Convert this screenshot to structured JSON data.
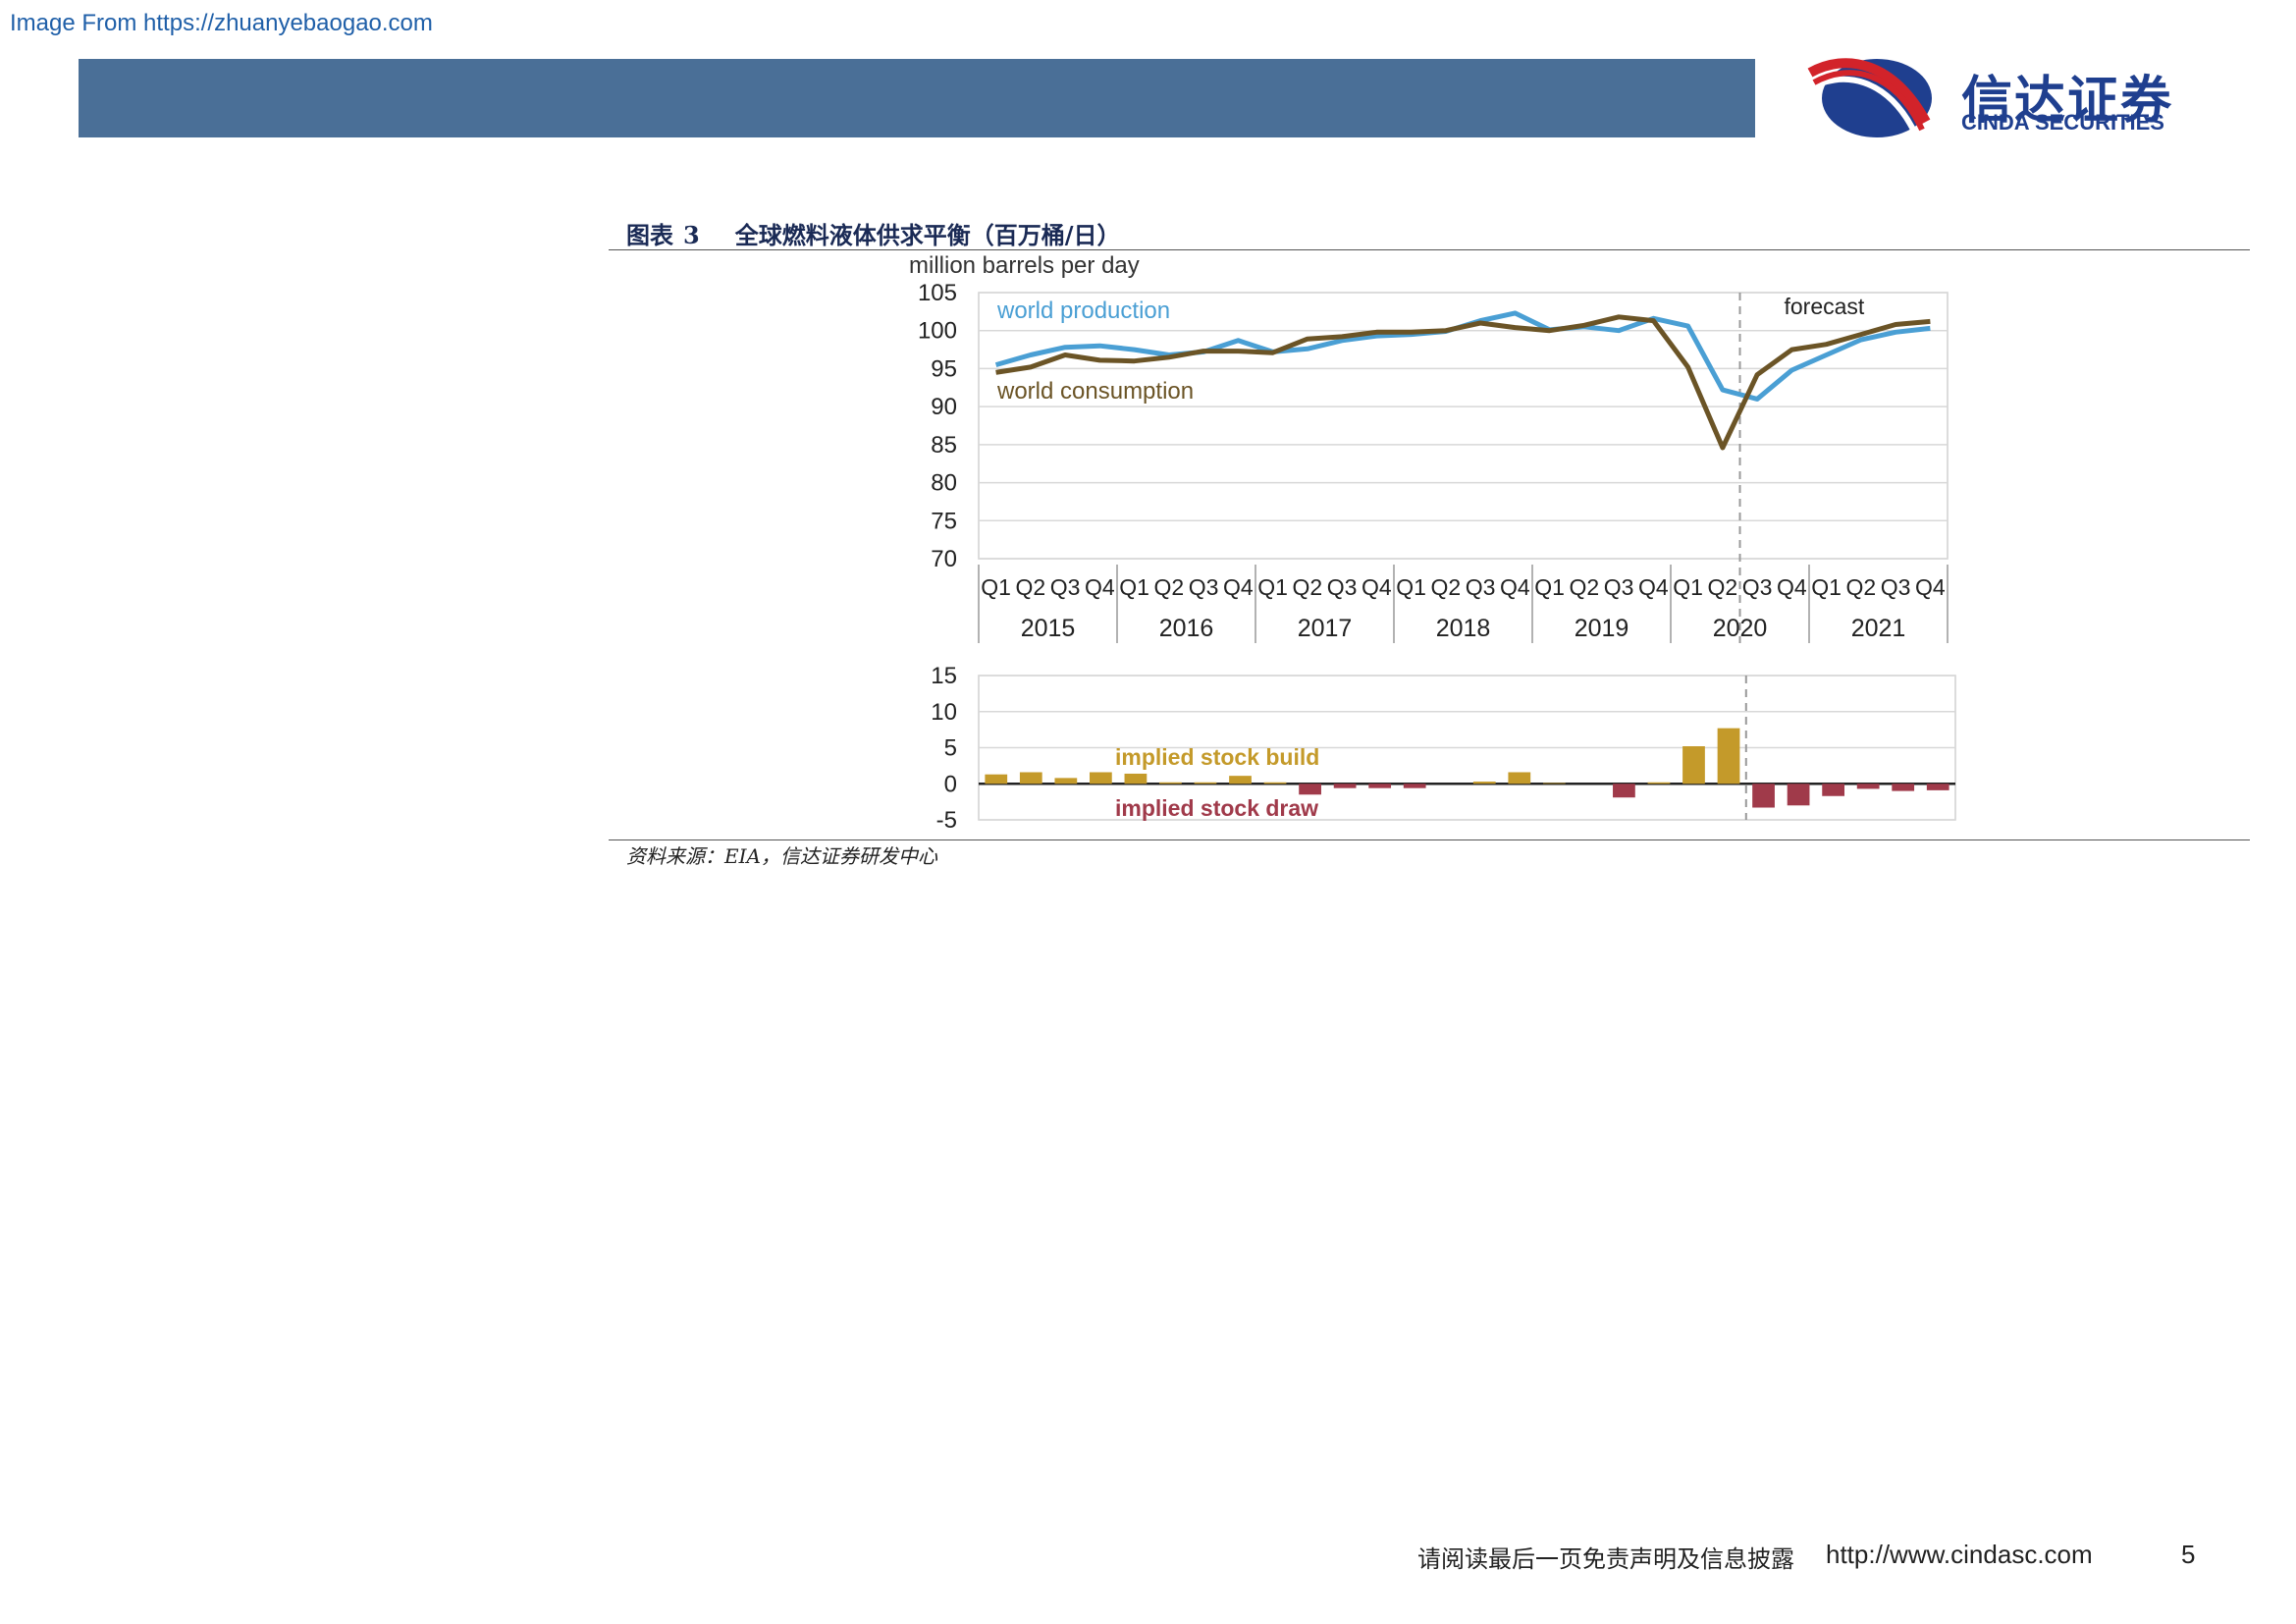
{
  "watermark": "Image From https://zhuanyebaogao.com",
  "logo": {
    "cn": "信达证券",
    "en": "CINDA SECURITIES",
    "colors": {
      "red": "#d2232a",
      "blue": "#1f3f8f"
    }
  },
  "figure": {
    "label": "图表",
    "number": "3",
    "title": "全球燃料液体供求平衡（百万桶/日）",
    "source": "资料来源：EIA，信达证券研发中心"
  },
  "footer": {
    "note": "请阅读最后一页免责声明及信息披露",
    "url": "http://www.cindasc.com",
    "page": "5"
  },
  "chart_data": [
    {
      "type": "line",
      "ylabel": "million barrels per day",
      "ylim": [
        70,
        105
      ],
      "yticks": [
        105,
        100,
        95,
        90,
        85,
        80,
        75,
        70
      ],
      "grid": true,
      "categories": [
        "Q1",
        "Q2",
        "Q3",
        "Q4",
        "Q1",
        "Q2",
        "Q3",
        "Q4",
        "Q1",
        "Q2",
        "Q3",
        "Q4",
        "Q1",
        "Q2",
        "Q3",
        "Q4",
        "Q1",
        "Q2",
        "Q3",
        "Q4",
        "Q1",
        "Q2",
        "Q3",
        "Q4",
        "Q1",
        "Q2",
        "Q3",
        "Q4"
      ],
      "years": [
        "2015",
        "2016",
        "2017",
        "2018",
        "2019",
        "2020",
        "2021"
      ],
      "forecast_label": "forecast",
      "forecast_start_index": 22,
      "series": [
        {
          "name": "world production",
          "color": "#4a9fd4",
          "values": [
            95.5,
            96.8,
            97.8,
            98.0,
            97.5,
            96.8,
            97.2,
            98.7,
            97.2,
            97.6,
            98.7,
            99.3,
            99.5,
            99.9,
            101.3,
            102.3,
            100.1,
            100.5,
            100.0,
            101.6,
            100.6,
            92.2,
            91.0,
            94.8,
            96.8,
            98.8,
            99.8,
            100.3
          ]
        },
        {
          "name": "world consumption",
          "color": "#6b5426",
          "values": [
            94.5,
            95.2,
            96.8,
            96.1,
            96.0,
            96.5,
            97.3,
            97.3,
            97.1,
            98.9,
            99.2,
            99.8,
            99.8,
            100.0,
            101.0,
            100.4,
            100.0,
            100.7,
            101.8,
            101.3,
            95.2,
            84.6,
            94.2,
            97.5,
            98.2,
            99.5,
            100.8,
            101.2
          ]
        }
      ]
    },
    {
      "type": "bar",
      "ylim": [
        -5,
        15
      ],
      "yticks": [
        15,
        10,
        5,
        0,
        -5
      ],
      "annotations": {
        "build": "implied stock build",
        "draw": "implied stock draw"
      },
      "colors": {
        "build": "#c49a2a",
        "draw": "#a03a4a"
      },
      "values": [
        1.3,
        1.6,
        0.8,
        1.6,
        1.4,
        0.2,
        0.2,
        1.1,
        0.2,
        -1.5,
        -0.6,
        -0.6,
        -0.6,
        0.0,
        0.3,
        1.6,
        0.1,
        0.0,
        -1.9,
        0.2,
        5.2,
        7.7,
        -3.3,
        -3.0,
        -1.7,
        -0.7,
        -1.0,
        -0.9
      ],
      "forecast_start_index": 22
    }
  ]
}
